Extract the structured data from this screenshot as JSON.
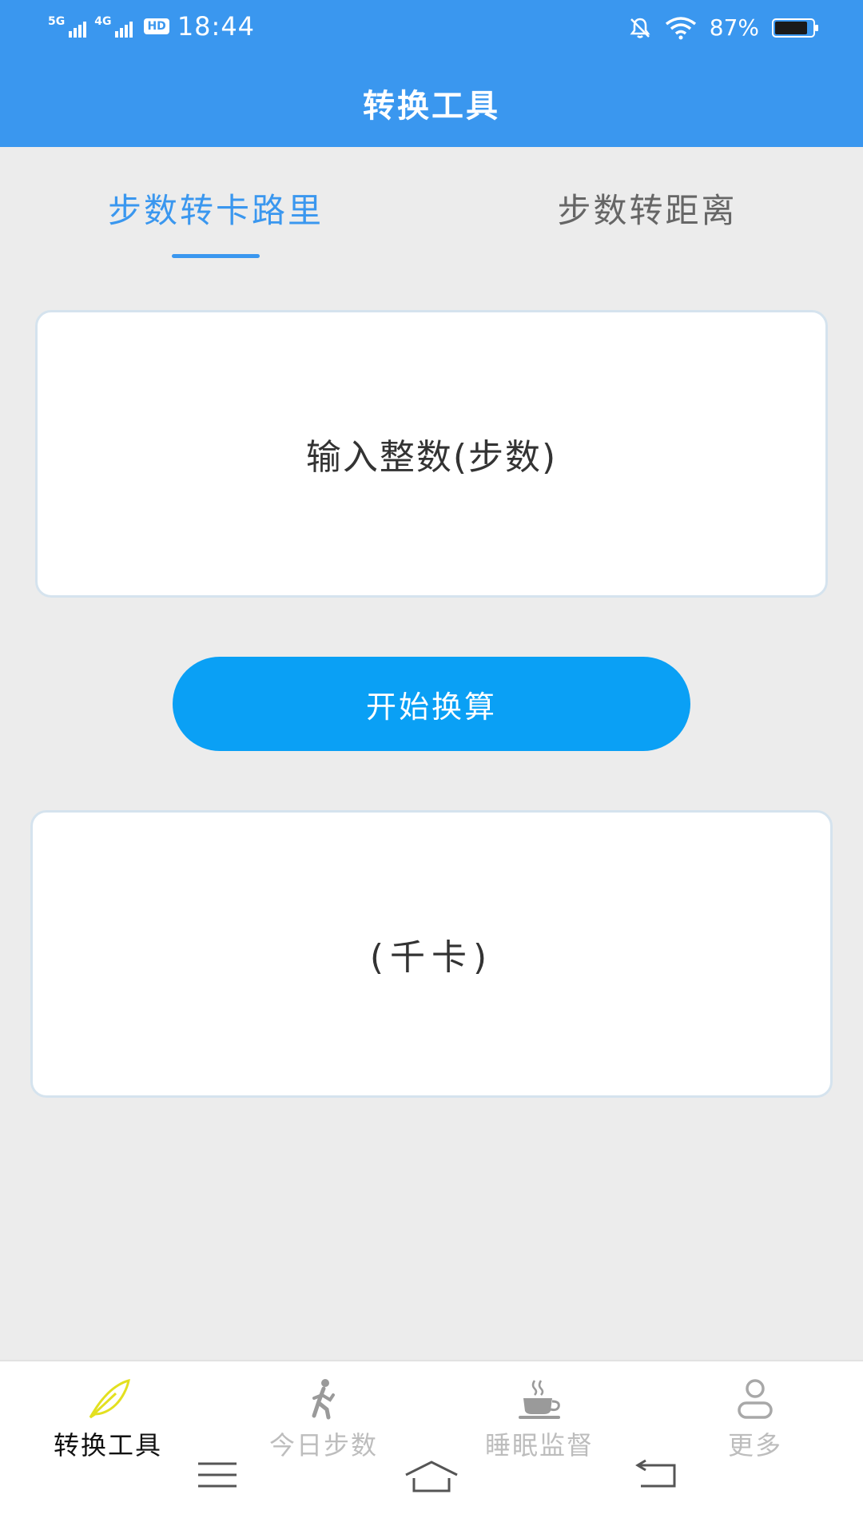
{
  "status_bar": {
    "network_1": "5G",
    "network_2": "4G",
    "hd_badge": "HD",
    "time": "18:44",
    "battery_percent": "87%",
    "battery_level": 0.87,
    "icons": [
      "bell-muted-icon",
      "wifi-icon",
      "battery-icon"
    ]
  },
  "header": {
    "title": "转换工具"
  },
  "tabs": [
    {
      "label": "步数转卡路里",
      "active": true
    },
    {
      "label": "步数转距离",
      "active": false
    }
  ],
  "input_card": {
    "placeholder": "输入整数(步数)"
  },
  "convert_button": {
    "label": "开始换算"
  },
  "result_card": {
    "unit": "(千卡)"
  },
  "bottom_nav": [
    {
      "label": "转换工具",
      "icon": "feather-icon",
      "active": true
    },
    {
      "label": "今日步数",
      "icon": "walking-person-icon",
      "active": false
    },
    {
      "label": "睡眠监督",
      "icon": "coffee-cup-icon",
      "active": false
    },
    {
      "label": "更多",
      "icon": "user-icon",
      "active": false
    }
  ],
  "colors": {
    "primary": "#3a97ef",
    "button": "#0aa0f5",
    "feather": "#e3e020",
    "inactive_nav": "#bdbdbd"
  }
}
